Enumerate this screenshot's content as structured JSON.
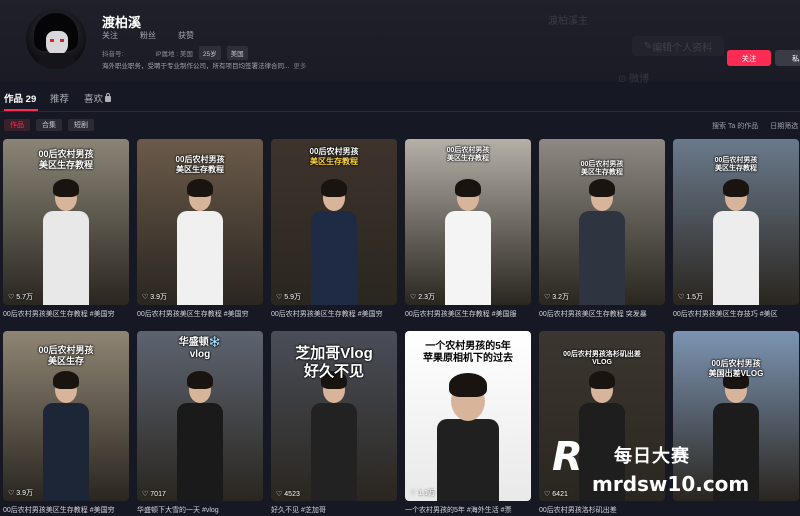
{
  "profile": {
    "username": "渡柏溪",
    "stats": {
      "following": "关注",
      "followers": "粉丝",
      "likes": "获赞"
    },
    "meta": {
      "id_label": "抖音号:",
      "ip_label": "IP属地 : 美国",
      "age": "25岁",
      "country": "美国"
    },
    "bio": "海外职业职务，受聘于专业制作公司，所有项目均签署法律合同...",
    "bio_more": "更多",
    "ghost_title": "渡柏溪主",
    "edit_label": "编辑个人资料",
    "ghost_tab": "微博",
    "follow_label": "关注",
    "msg_label": "私"
  },
  "tabs": {
    "works": "作品",
    "works_count": "29",
    "recommend": "推荐",
    "likes": "喜欢"
  },
  "subtabs": [
    "作品",
    "合集",
    "短剧"
  ],
  "right_links": {
    "search": "搜索 Ta 的作品",
    "sort": "日期筛选"
  },
  "videos": [
    {
      "title_line1": "00后农村男孩",
      "title_line2": "美区生存教程",
      "views": "5.7万",
      "caption": "00后农村男孩美区生存教程 #美国穷",
      "bg": "#8a8576"
    },
    {
      "title_line1": "00后农村男孩",
      "title_line2": "美区生存教程",
      "views": "3.9万",
      "caption": "00后农村男孩美区生存教程 #美国穷",
      "bg": "#6b5a4a"
    },
    {
      "title_line1": "00后农村男孩",
      "title_line2": "美区生存教程",
      "views": "5.9万",
      "caption": "00后农村男孩美区生存教程 #美国穷",
      "bg": "#3d342c"
    },
    {
      "title_line1": "00后农村男孩",
      "title_line2": "美区生存教程",
      "views": "2.3万",
      "caption": "00后农村男孩美区生存教程 #美国服",
      "bg": "#b4b0a8"
    },
    {
      "title_line1": "00后农村男孩",
      "title_line2": "美区生存教程",
      "views": "3.2万",
      "caption": "00后农村男孩美区生存教程 突发暴",
      "bg": "#8e8a83"
    },
    {
      "title_line1": "00后农村男孩",
      "title_line2": "美区生存教程",
      "views": "1.5万",
      "caption": "00后农村男孩美区生存技巧 #美区",
      "bg": "#6a7a8c"
    },
    {
      "title_line1": "00后农村男孩",
      "title_line2": "美区生存",
      "views": "3.9万",
      "caption": "00后农村男孩美区生存教程 #美国穷",
      "bg": "#8f8574"
    },
    {
      "title_line1": "华盛顿❄️",
      "title_line2": "vlog",
      "views": "7017",
      "caption": "华盛顿下大雪的一天 #vlog",
      "bg": "#5d6470"
    },
    {
      "title_line1": "芝加哥Vlog",
      "title_line2": "好久不见",
      "views": "4523",
      "caption": "好久不见 #芝加哥",
      "bg": "#4a4e58"
    },
    {
      "title_line1": "一个农村男孩的5年",
      "title_line2": "苹果原相机下的过去",
      "views": "1.1万",
      "caption": "一个农村男孩的5年 #海外生活 #票",
      "bg": "#f2f2f2"
    },
    {
      "title_line1": "00后农村男孩洛杉矶出差",
      "title_line2": "VLOG",
      "views": "6421",
      "caption": "00后农村男孩洛杉矶出差",
      "bg": "#3c3630"
    },
    {
      "title_line1": "00后农村男孩",
      "title_line2": "美国出差VLOG",
      "views": "",
      "caption": "",
      "bg": "#7c94b2"
    }
  ],
  "watermark": {
    "brand": "每日大赛",
    "url": "mrdsw10.com",
    "logo_letter": "R"
  }
}
